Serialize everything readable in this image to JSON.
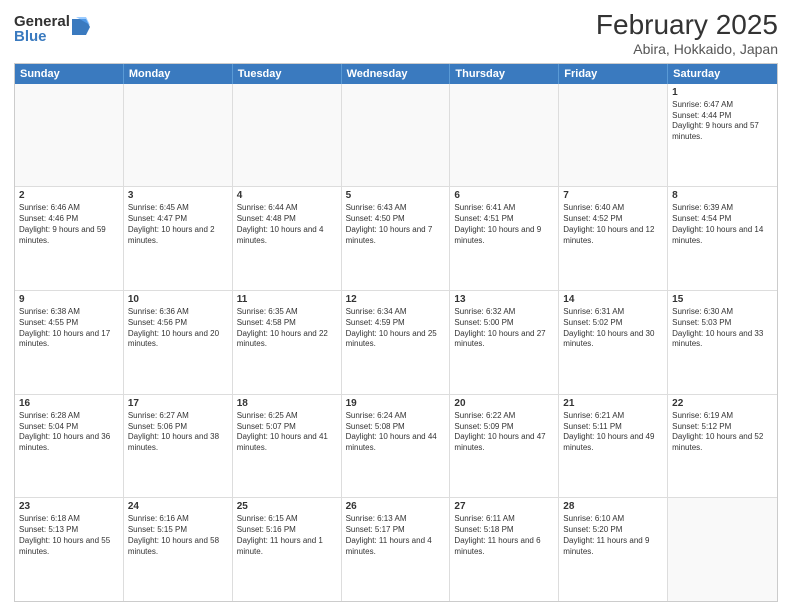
{
  "logo": {
    "general": "General",
    "blue": "Blue"
  },
  "header": {
    "month": "February 2025",
    "location": "Abira, Hokkaido, Japan"
  },
  "weekdays": [
    "Sunday",
    "Monday",
    "Tuesday",
    "Wednesday",
    "Thursday",
    "Friday",
    "Saturday"
  ],
  "weeks": [
    [
      {
        "day": "",
        "empty": true
      },
      {
        "day": "",
        "empty": true
      },
      {
        "day": "",
        "empty": true
      },
      {
        "day": "",
        "empty": true
      },
      {
        "day": "",
        "empty": true
      },
      {
        "day": "",
        "empty": true
      },
      {
        "day": "1",
        "info": "Sunrise: 6:47 AM\nSunset: 4:44 PM\nDaylight: 9 hours and 57 minutes."
      }
    ],
    [
      {
        "day": "2",
        "info": "Sunrise: 6:46 AM\nSunset: 4:46 PM\nDaylight: 9 hours and 59 minutes."
      },
      {
        "day": "3",
        "info": "Sunrise: 6:45 AM\nSunset: 4:47 PM\nDaylight: 10 hours and 2 minutes."
      },
      {
        "day": "4",
        "info": "Sunrise: 6:44 AM\nSunset: 4:48 PM\nDaylight: 10 hours and 4 minutes."
      },
      {
        "day": "5",
        "info": "Sunrise: 6:43 AM\nSunset: 4:50 PM\nDaylight: 10 hours and 7 minutes."
      },
      {
        "day": "6",
        "info": "Sunrise: 6:41 AM\nSunset: 4:51 PM\nDaylight: 10 hours and 9 minutes."
      },
      {
        "day": "7",
        "info": "Sunrise: 6:40 AM\nSunset: 4:52 PM\nDaylight: 10 hours and 12 minutes."
      },
      {
        "day": "8",
        "info": "Sunrise: 6:39 AM\nSunset: 4:54 PM\nDaylight: 10 hours and 14 minutes."
      }
    ],
    [
      {
        "day": "9",
        "info": "Sunrise: 6:38 AM\nSunset: 4:55 PM\nDaylight: 10 hours and 17 minutes."
      },
      {
        "day": "10",
        "info": "Sunrise: 6:36 AM\nSunset: 4:56 PM\nDaylight: 10 hours and 20 minutes."
      },
      {
        "day": "11",
        "info": "Sunrise: 6:35 AM\nSunset: 4:58 PM\nDaylight: 10 hours and 22 minutes."
      },
      {
        "day": "12",
        "info": "Sunrise: 6:34 AM\nSunset: 4:59 PM\nDaylight: 10 hours and 25 minutes."
      },
      {
        "day": "13",
        "info": "Sunrise: 6:32 AM\nSunset: 5:00 PM\nDaylight: 10 hours and 27 minutes."
      },
      {
        "day": "14",
        "info": "Sunrise: 6:31 AM\nSunset: 5:02 PM\nDaylight: 10 hours and 30 minutes."
      },
      {
        "day": "15",
        "info": "Sunrise: 6:30 AM\nSunset: 5:03 PM\nDaylight: 10 hours and 33 minutes."
      }
    ],
    [
      {
        "day": "16",
        "info": "Sunrise: 6:28 AM\nSunset: 5:04 PM\nDaylight: 10 hours and 36 minutes."
      },
      {
        "day": "17",
        "info": "Sunrise: 6:27 AM\nSunset: 5:06 PM\nDaylight: 10 hours and 38 minutes."
      },
      {
        "day": "18",
        "info": "Sunrise: 6:25 AM\nSunset: 5:07 PM\nDaylight: 10 hours and 41 minutes."
      },
      {
        "day": "19",
        "info": "Sunrise: 6:24 AM\nSunset: 5:08 PM\nDaylight: 10 hours and 44 minutes."
      },
      {
        "day": "20",
        "info": "Sunrise: 6:22 AM\nSunset: 5:09 PM\nDaylight: 10 hours and 47 minutes."
      },
      {
        "day": "21",
        "info": "Sunrise: 6:21 AM\nSunset: 5:11 PM\nDaylight: 10 hours and 49 minutes."
      },
      {
        "day": "22",
        "info": "Sunrise: 6:19 AM\nSunset: 5:12 PM\nDaylight: 10 hours and 52 minutes."
      }
    ],
    [
      {
        "day": "23",
        "info": "Sunrise: 6:18 AM\nSunset: 5:13 PM\nDaylight: 10 hours and 55 minutes."
      },
      {
        "day": "24",
        "info": "Sunrise: 6:16 AM\nSunset: 5:15 PM\nDaylight: 10 hours and 58 minutes."
      },
      {
        "day": "25",
        "info": "Sunrise: 6:15 AM\nSunset: 5:16 PM\nDaylight: 11 hours and 1 minute."
      },
      {
        "day": "26",
        "info": "Sunrise: 6:13 AM\nSunset: 5:17 PM\nDaylight: 11 hours and 4 minutes."
      },
      {
        "day": "27",
        "info": "Sunrise: 6:11 AM\nSunset: 5:18 PM\nDaylight: 11 hours and 6 minutes."
      },
      {
        "day": "28",
        "info": "Sunrise: 6:10 AM\nSunset: 5:20 PM\nDaylight: 11 hours and 9 minutes."
      },
      {
        "day": "",
        "empty": true
      }
    ]
  ]
}
